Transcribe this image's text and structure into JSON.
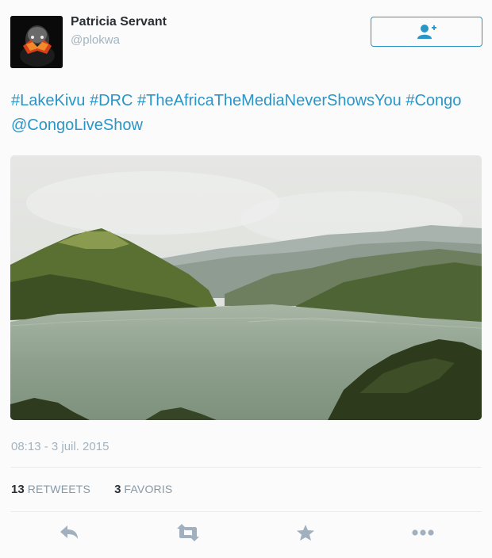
{
  "user": {
    "name": "Patricia Servant",
    "handle": "@plokwa",
    "avatar": "avatar-dark-portrait"
  },
  "follow_button": {
    "icon": "add-user-icon"
  },
  "tweet": {
    "text_parts": [
      "#LakeKivu",
      "#DRC",
      "#TheAfricaTheMediaNeverShowsYou",
      "#Congo",
      "@CongoLiveShow"
    ],
    "photo": "lake-landscape-photo",
    "timestamp": "08:13 - 3 juil. 2015"
  },
  "stats": {
    "retweets_count": "13",
    "retweets_label": "RETWEETS",
    "favorites_count": "3",
    "favorites_label": "FAVORIS"
  },
  "actions": [
    {
      "icon": "reply-icon"
    },
    {
      "icon": "retweet-icon"
    },
    {
      "icon": "favorite-star-icon"
    },
    {
      "icon": "more-options-icon"
    }
  ],
  "colors": {
    "link": "#2a95c7",
    "muted": "#a2b4c0",
    "icon": "#a0b0be",
    "text": "#292f33"
  }
}
